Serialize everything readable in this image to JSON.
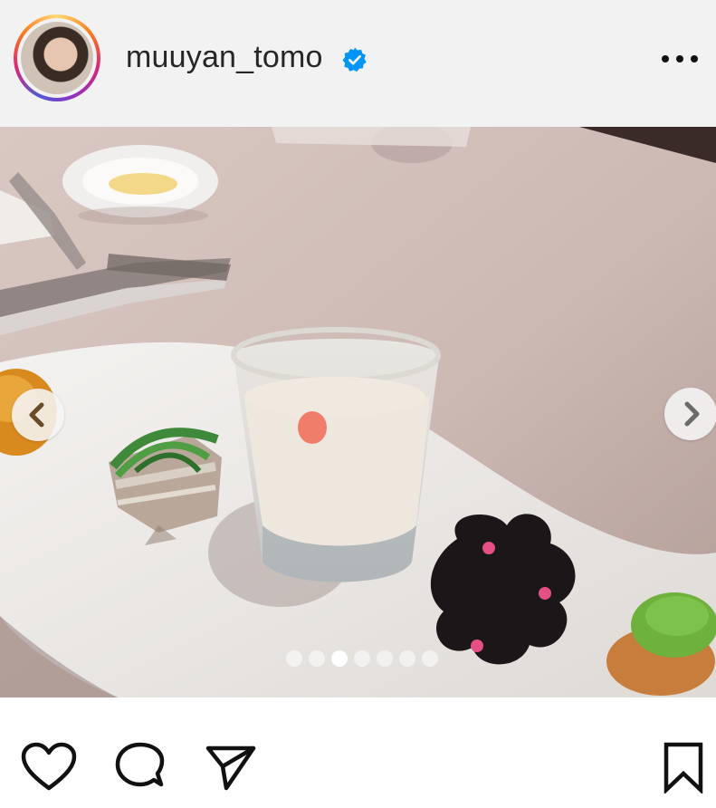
{
  "post": {
    "username": "muuyan_tomo",
    "verified": true,
    "menu_icon": "more-horizontal-icon",
    "carousel": {
      "total_images": 7,
      "active_index": 2
    }
  },
  "actions": {
    "like_icon": "heart-icon",
    "comment_icon": "comment-icon",
    "share_icon": "share-icon",
    "save_icon": "bookmark-icon"
  },
  "colors": {
    "header_bg": "#f2f2f2",
    "verified_blue": "#0095f6",
    "text": "#262626"
  }
}
